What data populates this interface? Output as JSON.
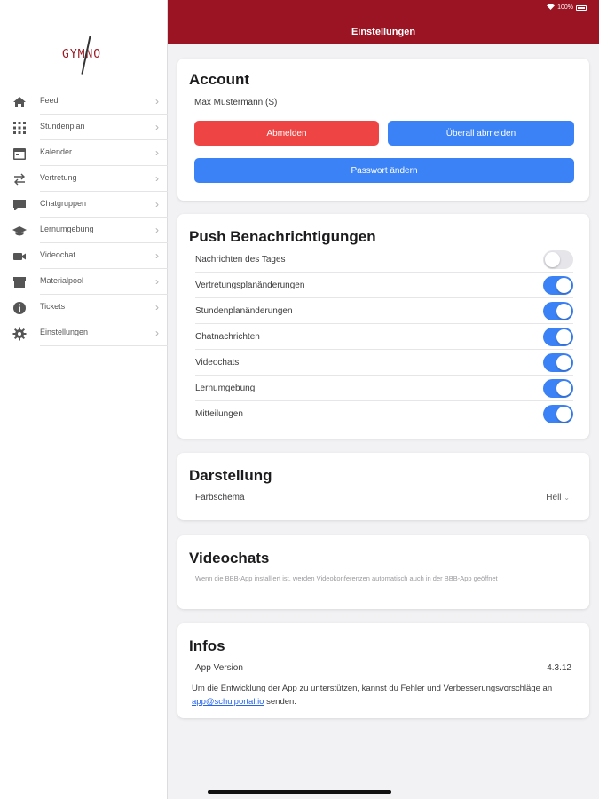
{
  "app": {
    "logo_text": "GYMNO"
  },
  "status": {
    "battery": "100%"
  },
  "header": {
    "title": "Einstellungen"
  },
  "sidebar": {
    "items": [
      {
        "label": "Feed",
        "icon": "home-icon"
      },
      {
        "label": "Stundenplan",
        "icon": "grid-icon"
      },
      {
        "label": "Kalender",
        "icon": "calendar-icon"
      },
      {
        "label": "Vertretung",
        "icon": "swap-arrows-icon"
      },
      {
        "label": "Chatgruppen",
        "icon": "chat-bubble-icon"
      },
      {
        "label": "Lernumgebung",
        "icon": "graduation-cap-icon"
      },
      {
        "label": "Videochat",
        "icon": "video-camera-icon"
      },
      {
        "label": "Materialpool",
        "icon": "archive-box-icon"
      },
      {
        "label": "Tickets",
        "icon": "info-circle-icon"
      },
      {
        "label": "Einstellungen",
        "icon": "gear-icon"
      }
    ]
  },
  "account": {
    "title": "Account",
    "user": "Max Mustermann (S)",
    "logout_label": "Abmelden",
    "logout_all_label": "Überall abmelden",
    "change_password_label": "Passwort ändern"
  },
  "push": {
    "title": "Push Benachrichtigungen",
    "items": [
      {
        "label": "Nachrichten des Tages",
        "enabled": false
      },
      {
        "label": "Vertretungsplanänderungen",
        "enabled": true
      },
      {
        "label": "Stundenplanänderungen",
        "enabled": true
      },
      {
        "label": "Chatnachrichten",
        "enabled": true
      },
      {
        "label": "Videochats",
        "enabled": true
      },
      {
        "label": "Lernumgebung",
        "enabled": true
      },
      {
        "label": "Mitteilungen",
        "enabled": true
      }
    ]
  },
  "display": {
    "title": "Darstellung",
    "color_scheme_label": "Farbschema",
    "color_scheme_value": "Hell"
  },
  "videochats": {
    "title": "Videochats",
    "description": "Wenn die BBB-App installiert ist, werden Videokonferenzen automatisch auch in der BBB-App geöffnet"
  },
  "infos": {
    "title": "Infos",
    "version_label": "App Version",
    "version_value": "4.3.12",
    "support_text_before": "Um die Entwicklung der App zu unterstützen, kannst du Fehler und Verbesserungsvorschläge an",
    "support_email": "app@schulportal.io",
    "support_text_after": "senden."
  },
  "colors": {
    "brand": "#9a1424",
    "danger": "#ef4444",
    "primary": "#3b82f6"
  }
}
